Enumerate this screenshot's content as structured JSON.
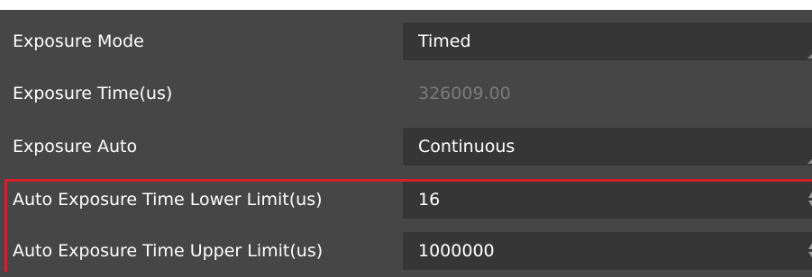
{
  "properties": [
    {
      "label": "Exposure Mode",
      "value": "Timed",
      "editable": true,
      "control": "dropdown"
    },
    {
      "label": "Exposure Time(us)",
      "value": "326009.00",
      "editable": false,
      "control": "readonly"
    },
    {
      "label": "Exposure Auto",
      "value": "Continuous",
      "editable": true,
      "control": "dropdown"
    },
    {
      "label": "Auto Exposure Time Lower Limit(us)",
      "value": "16",
      "editable": true,
      "control": "spinner"
    },
    {
      "label": "Auto Exposure Time Upper Limit(us)",
      "value": "1000000",
      "editable": true,
      "control": "spinner"
    }
  ],
  "colors": {
    "panel_background": "#464646",
    "field_background": "#363636",
    "disabled_text": "#7a7a7a",
    "highlight_border": "#d8202a"
  }
}
